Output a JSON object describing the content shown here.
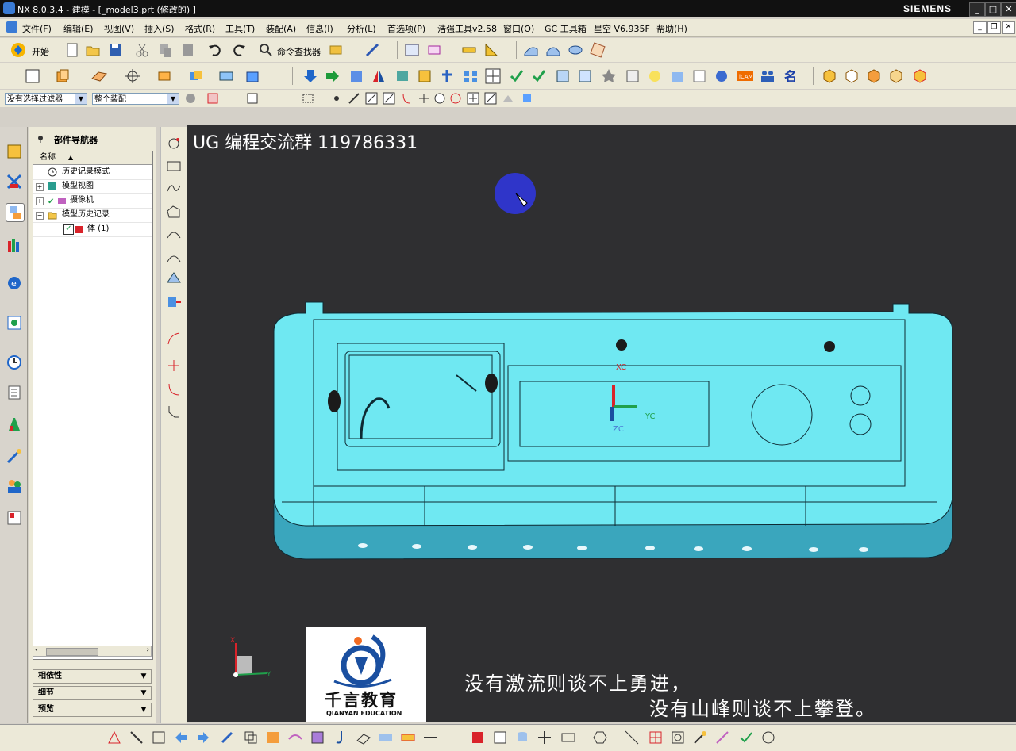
{
  "window": {
    "title": "NX 8.0.3.4 - 建模 - [_model3.prt (修改的) ]",
    "brand": "SIEMENS",
    "min_label": "_",
    "max_label": "□",
    "close_label": "✕"
  },
  "menubar": {
    "items": [
      "文件(F)",
      "编辑(E)",
      "视图(V)",
      "插入(S)",
      "格式(R)",
      "工具(T)",
      "装配(A)",
      "信息(I)",
      "分析(L)",
      "首选项(P)",
      "浩强工具v2.58",
      "窗口(O)",
      "GC 工具箱",
      "星空 V6.935F",
      "帮助(H)"
    ],
    "doc_min": "_",
    "doc_restore": "❐",
    "doc_close": "✕"
  },
  "toolbar1": {
    "start_label": "开始",
    "command_finder_label": "命令查找器"
  },
  "filter": {
    "selection_filter": "没有选择过滤器",
    "assembly_scope": "整个装配"
  },
  "navigator": {
    "title": "部件导航器",
    "column_name": "名称",
    "rows": [
      {
        "label": "历史记录模式"
      },
      {
        "label": "模型视图"
      },
      {
        "label": "摄像机"
      },
      {
        "label": "模型历史记录"
      },
      {
        "label": "体 (1)"
      }
    ],
    "panels": [
      "相依性",
      "细节",
      "预览"
    ]
  },
  "viewport": {
    "watermark": "UG 编程交流群 119786331",
    "axis_labels": {
      "xc": "XC",
      "yc": "YC",
      "zc": "ZC",
      "x": "X",
      "y": "Y"
    },
    "logo_cn": "千言教育",
    "logo_en": "QIANYAN EDUCATION",
    "subtitle_line1": "没有激流则谈不上勇进，",
    "subtitle_line2": "没有山峰则谈不上攀登。"
  },
  "colors": {
    "part": "#6fe8f2",
    "part_side": "#3aa6bd",
    "viewport_bg": "#2f2f31",
    "cursor_circle": "#2f35c9",
    "accent_red": "#d9232a",
    "accent_blue": "#1a4fa0"
  }
}
